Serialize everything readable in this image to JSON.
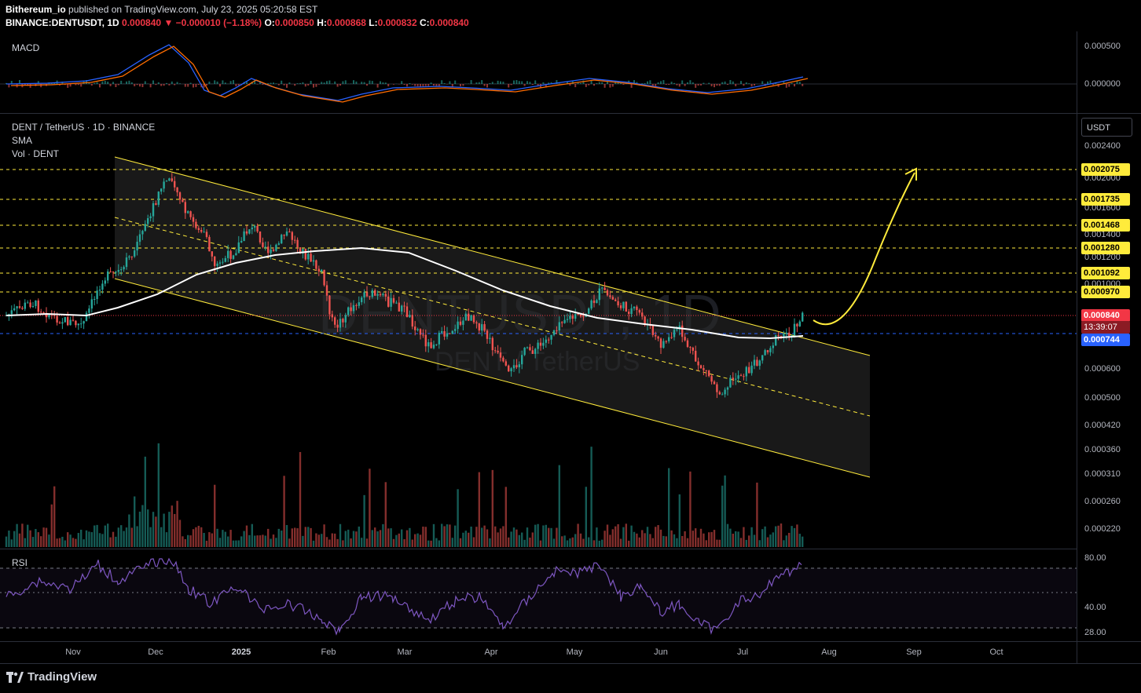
{
  "header": {
    "publisher": "Bithereum_io",
    "published_text": "published on TradingView.com, July 23, 2025 05:20:58 EST",
    "symbol": "BINANCE:DENTUSDT, 1D",
    "last": "0.000840",
    "change_arrow": "▼",
    "change": "−0.000010 (−1.18%)",
    "o_label": "O:",
    "o": "0.000850",
    "h_label": "H:",
    "h": "0.000868",
    "l_label": "L:",
    "l": "0.000832",
    "c_label": "C:",
    "c": "0.000840"
  },
  "panes": {
    "macd_label": "MACD",
    "main_title": "DENT / TetherUS · 1D · BINANCE",
    "sma_label": "SMA",
    "vol_label": "Vol · DENT",
    "rsi_label": "RSI"
  },
  "watermark": {
    "line1": "DENTUSDT, 1D",
    "line2": "DENT / TetherUS"
  },
  "currency_button": "USDT",
  "macd_axis": [
    "0.000500",
    "0.000000"
  ],
  "price_axis_ticks": [
    "0.002400",
    "0.002000",
    "0.001600",
    "0.001400",
    "0.001200",
    "0.001000",
    "0.000600",
    "0.000500",
    "0.000420",
    "0.000360",
    "0.000310",
    "0.000260",
    "0.000220"
  ],
  "levels": [
    "0.002075",
    "0.001735",
    "0.001468",
    "0.001280",
    "0.001092",
    "0.000970"
  ],
  "current_price": "0.000840",
  "countdown": "13:39:07",
  "sma_price": "0.000744",
  "rsi_axis": [
    "80.00",
    "40.00",
    "28.00"
  ],
  "x_axis": [
    "Nov",
    "Dec",
    "2025",
    "Feb",
    "Mar",
    "Apr",
    "May",
    "Jun",
    "Jul",
    "Aug",
    "Sep",
    "Oct"
  ],
  "brand": "TradingView",
  "colors": {
    "up": "#26a69a",
    "down": "#ef5350",
    "level": "#ffeb3b",
    "sma": "#ffffff",
    "rsi": "#7e57c2",
    "macd": "#2962ff",
    "signal": "#ff6d00"
  },
  "icons": {
    "logo": "tradingview-logo-icon",
    "arrow": "projection-arrow-icon"
  }
}
